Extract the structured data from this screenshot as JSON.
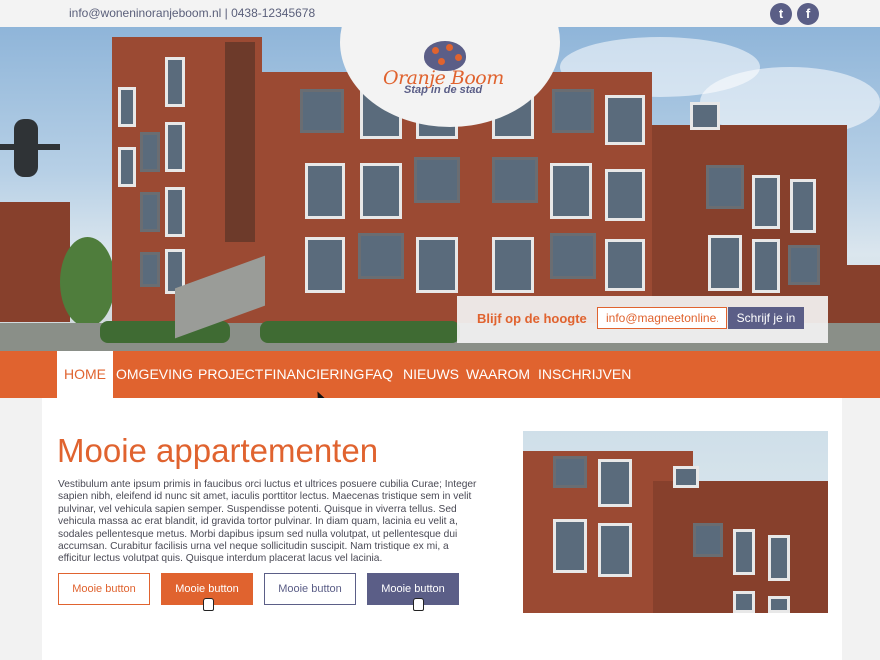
{
  "topbar": {
    "contact": "info@woneninoranjeboom.nl | 0438-12345678",
    "twitter_icon": "twitter-icon",
    "facebook_icon": "facebook-icon"
  },
  "logo": {
    "name": "Oranje Boom",
    "tagline": "Stap in de stad"
  },
  "newsletter": {
    "label": "Blijf op de hoogte",
    "email_value": "info@magneetonline.nl",
    "button": "Schrijf je in"
  },
  "nav": {
    "items": [
      "HOME",
      "OMGEVING",
      "PROJECT",
      "FINANCIERING",
      "FAQ",
      "NIEUWS",
      "WAAROM",
      "INSCHRIJVEN"
    ],
    "active": "HOME"
  },
  "main": {
    "heading": "Mooie appartementen",
    "body": "Vestibulum ante ipsum primis in faucibus orci luctus et ultrices posuere cubilia Curae; Integer sapien nibh, eleifend id nunc sit amet, iaculis porttitor lectus. Maecenas tristique sem in velit pulvinar, vel vehicula sapien semper. Suspendisse potenti. Quisque in viverra tellus. Sed vehicula massa ac erat blandit, id gravida tortor pulvinar. In diam quam, lacinia eu velit a, sodales pellentesque metus. Morbi dapibus ipsum sed nulla volutpat, ut pellentesque dui accumsan. Curabitur facilisis urna vel neque sollicitudin suscipit. Nam tristique ex mi, a efficitur lectus volutpat quis. Quisque interdum placerat lacus vel lacinia.",
    "buttons": [
      "Mooie button",
      "Mooie button",
      "Mooie button",
      "Mooie button"
    ]
  },
  "colors": {
    "accent": "#e0632f",
    "secondary": "#5b5e87",
    "brick": "#9b4a33"
  }
}
